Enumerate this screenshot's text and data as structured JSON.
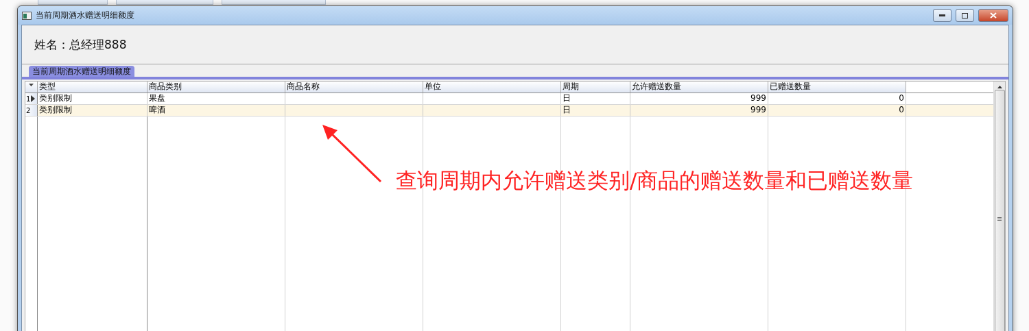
{
  "window": {
    "title": "当前周期酒水赠送明细额度"
  },
  "name_label": "姓名：总经理888",
  "tabs": [
    {
      "label": "当前周期酒水赠送明细额度",
      "selected": true
    }
  ],
  "table": {
    "columns": [
      "类型",
      "商品类别",
      "商品名称",
      "单位",
      "周期",
      "允许赠送数量",
      "已赠送数量"
    ],
    "rows": [
      {
        "number": "1",
        "selected": true,
        "cells": [
          "类别限制",
          "果盘",
          "",
          "",
          "日",
          "999",
          "0"
        ]
      },
      {
        "number": "2",
        "selected": false,
        "cells": [
          "类别限制",
          "啤酒",
          "",
          "",
          "日",
          "999",
          "0"
        ]
      }
    ]
  },
  "annotation": "查询周期内允许赠送类别/商品的赠送数量和已赠送数量"
}
